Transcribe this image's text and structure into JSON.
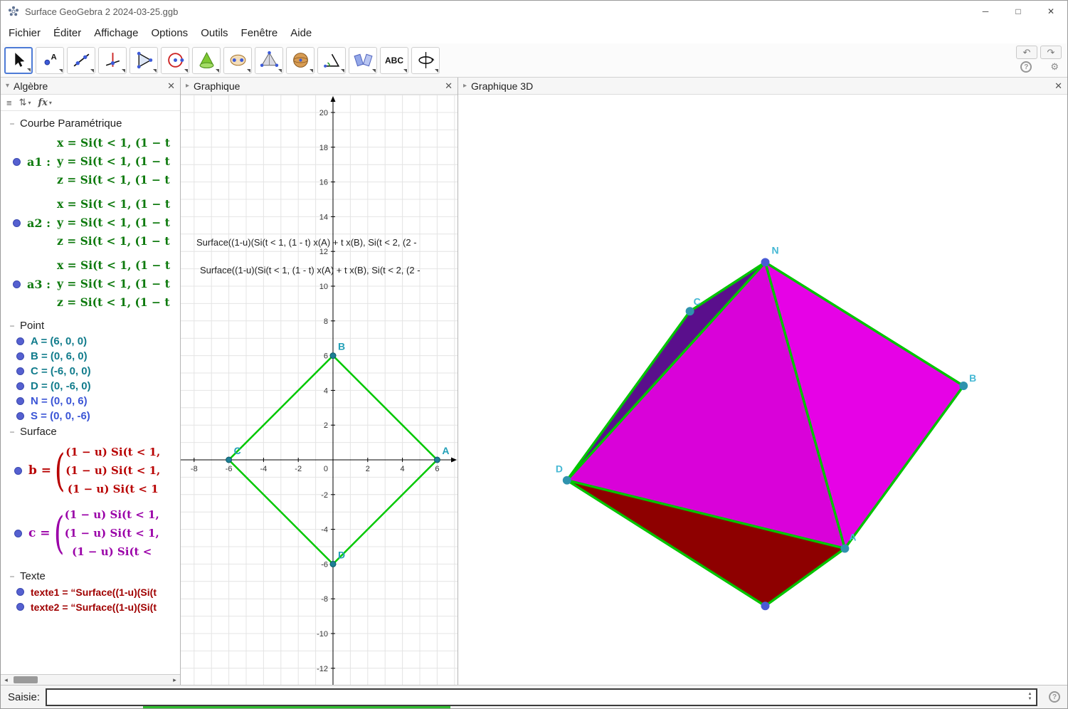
{
  "window": {
    "title": "Surface GeoGebra 2 2024-03-25.ggb",
    "controls": {
      "minimize": "─",
      "maximize": "□",
      "close": "✕"
    }
  },
  "menu": {
    "items": [
      "Fichier",
      "Éditer",
      "Affichage",
      "Options",
      "Outils",
      "Fenêtre",
      "Aide"
    ]
  },
  "toolbar": {
    "tools": [
      {
        "name": "move-tool",
        "selected": true
      },
      {
        "name": "point-tool",
        "selected": false
      },
      {
        "name": "line-tool",
        "selected": false
      },
      {
        "name": "perpendicular-line-tool",
        "selected": false
      },
      {
        "name": "polygon-tool",
        "selected": false
      },
      {
        "name": "circle-tool",
        "selected": false
      },
      {
        "name": "cone-tool",
        "selected": false
      },
      {
        "name": "intersection-curve-tool",
        "selected": false
      },
      {
        "name": "pyramid-tool",
        "selected": false
      },
      {
        "name": "sphere-tool",
        "selected": false
      },
      {
        "name": "angle-tool",
        "selected": false
      },
      {
        "name": "reflection-tool",
        "selected": false
      },
      {
        "name": "text-tool",
        "selected": false,
        "label": "ABC"
      },
      {
        "name": "rotate-view-tool",
        "selected": false
      }
    ],
    "undo_icon": "↶",
    "redo_icon": "↷",
    "help_icon": "?",
    "settings_icon": "⚙"
  },
  "algebra": {
    "title": "Algèbre",
    "header_icons": {
      "list": "≡",
      "sort": "⇅",
      "fx": "fx"
    },
    "sections": [
      {
        "name": "Courbe Paramétrique",
        "type": "curves",
        "items": [
          {
            "label": "a1 :",
            "rows": [
              "x = Si(t < 1, (1 − t",
              "y = Si(t < 1, (1 − t",
              "z = Si(t < 1, (1 − t"
            ]
          },
          {
            "label": "a2 :",
            "rows": [
              "x = Si(t < 1, (1 − t",
              "y = Si(t < 1, (1 − t",
              "z = Si(t < 1, (1 − t"
            ]
          },
          {
            "label": "a3 :",
            "rows": [
              "x = Si(t < 1, (1 − t",
              "y = Si(t < 1, (1 − t",
              "z = Si(t < 1, (1 − t"
            ]
          }
        ]
      },
      {
        "name": "Point",
        "type": "points",
        "items": [
          {
            "label": "A",
            "value": "(6, 0, 0)",
            "color": "#127c8c"
          },
          {
            "label": "B",
            "value": "(0, 6, 0)",
            "color": "#127c8c"
          },
          {
            "label": "C",
            "value": "(-6, 0, 0)",
            "color": "#127c8c"
          },
          {
            "label": "D",
            "value": "(0, -6, 0)",
            "color": "#127c8c"
          },
          {
            "label": "N",
            "value": "(0, 0, 6)",
            "color": "#3b55d6"
          },
          {
            "label": "S",
            "value": "(0, 0, -6)",
            "color": "#3b55d6"
          }
        ]
      },
      {
        "name": "Surface",
        "type": "surfaces",
        "items": [
          {
            "label": "b  =",
            "color": "#b80000",
            "rows": [
              "(1 − u) Si(t < 1,",
              "(1 − u) Si(t < 1,",
              "(1 − u) Si(t < 1"
            ]
          },
          {
            "label": "c  =",
            "color": "#9a00a8",
            "rows": [
              "(1 − u) Si(t < 1,",
              "(1 − u) Si(t < 1,",
              "(1 − u) Si(t <"
            ]
          }
        ]
      },
      {
        "name": "Texte",
        "type": "texts",
        "items": [
          {
            "text": "texte1 = “Surface((1-u)(Si(t"
          },
          {
            "text": "texte2 = “Surface((1-u)(Si(t"
          }
        ]
      }
    ]
  },
  "graphics2d": {
    "title": "Graphique",
    "x_ticks": [
      -8,
      -6,
      -4,
      -2,
      2,
      4,
      6
    ],
    "y_ticks": [
      -12,
      -10,
      -8,
      -6,
      -4,
      -2,
      2,
      4,
      6,
      8,
      10,
      12,
      14,
      16,
      18,
      20
    ],
    "origin_label": "0",
    "points": [
      {
        "label": "A",
        "coords": [
          6,
          0
        ]
      },
      {
        "label": "B",
        "coords": [
          0,
          6
        ]
      },
      {
        "label": "C",
        "coords": [
          -6,
          0
        ]
      },
      {
        "label": "D",
        "coords": [
          0,
          -6
        ]
      }
    ],
    "edge_color": "#00c800",
    "point_color": "#1d7f95",
    "overlay_texts": [
      "Surface((1-u)(Si(t < 1, (1 - t) x(A) + t x(B), Si(t < 2, (2 -",
      "Surface((1-u)(Si(t < 1, (1 - t) x(A) + t x(B), Si(t < 2, (2 -"
    ]
  },
  "graphics3d": {
    "title": "Graphique 3D",
    "vertex_labels": {
      "top": "N",
      "left_upper": "C",
      "right": "B",
      "left": "D",
      "bottom_right": "A"
    },
    "colors": {
      "face_front_left": "#d902d9",
      "face_front_right": "#e602e6",
      "face_shaded": "#5a0f8c",
      "face_bottom": "#8e0000",
      "edge": "#00c400",
      "label": "#45b8d4"
    }
  },
  "input_bar": {
    "label": "Saisie:",
    "value": "",
    "help_icon": "?"
  }
}
